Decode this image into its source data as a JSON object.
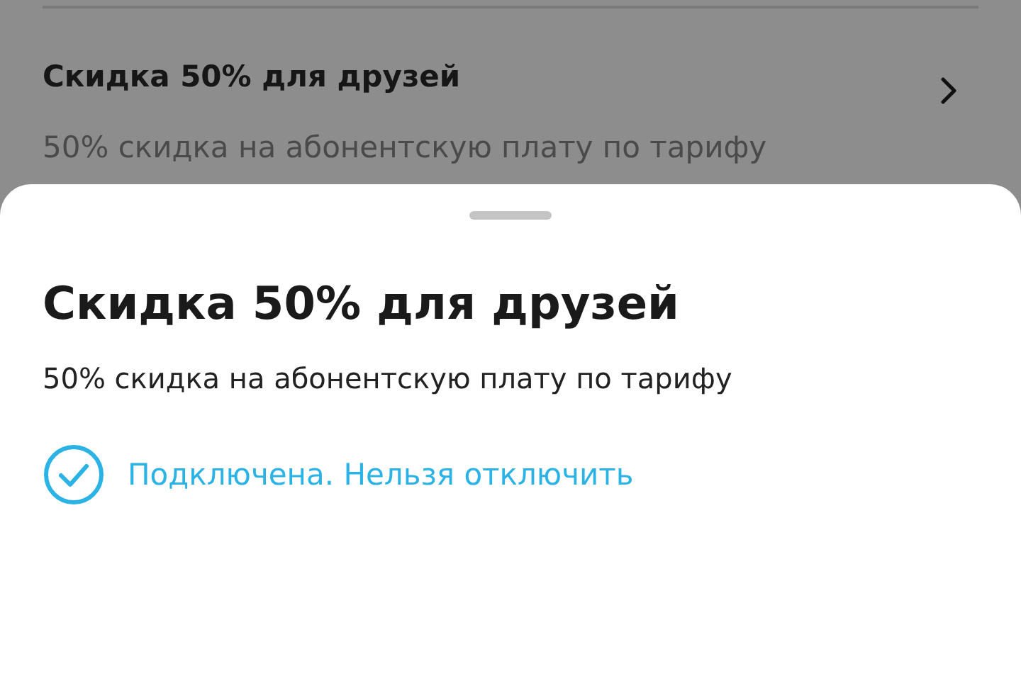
{
  "background_item": {
    "title": "Скидка 50% для друзей",
    "subtitle": "50% скидка на абонентскую плату по тарифу"
  },
  "sheet": {
    "title": "Скидка 50% для друзей",
    "description": "50% скидка на абонентскую плату по тарифу",
    "status": {
      "connected": true,
      "text": "Подключена. Нельзя отключить"
    }
  }
}
